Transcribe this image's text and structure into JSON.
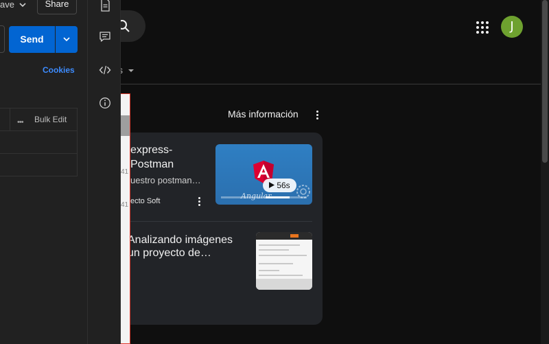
{
  "youtube": {
    "avatar_initial": "J",
    "avatar_color": "#6ea12f",
    "chip_label": "s",
    "more_info": "Más información",
    "video1": {
      "title": "express-\nPostman",
      "subtitle": "uestro postman…",
      "channel": "ecto Soft",
      "duration": "56s",
      "thumb_text": "Angular"
    },
    "video2": {
      "title": "Analizando imágenes\nun proyecto de…"
    },
    "side_nums": [
      "41",
      "41"
    ]
  },
  "postman": {
    "save_label": "ave",
    "share_label": "Share",
    "send_label": "Send",
    "cookies_label": "Cookies",
    "bulk_edit_label": "Bulk Edit",
    "accent_color": "#0265d2"
  },
  "sidebar_icons": [
    "document-icon",
    "comment-icon",
    "code-icon",
    "info-icon"
  ]
}
